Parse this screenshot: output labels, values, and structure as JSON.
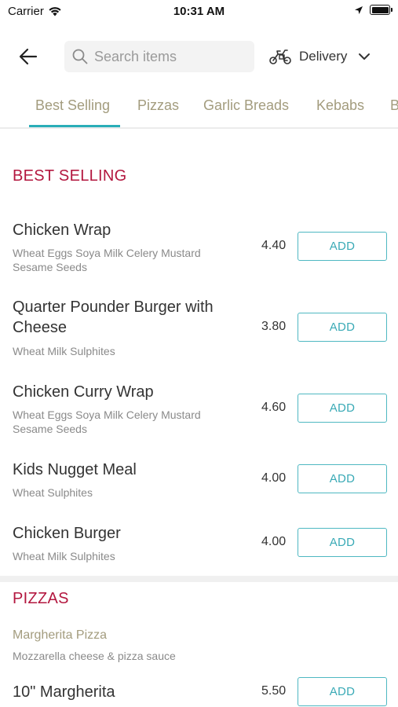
{
  "status_bar": {
    "carrier": "Carrier",
    "time": "10:31 AM"
  },
  "header": {
    "search_placeholder": "Search items",
    "delivery_label": "Delivery"
  },
  "tabs": [
    {
      "label": "Best Selling",
      "active": true
    },
    {
      "label": "Pizzas",
      "active": false
    },
    {
      "label": "Garlic Breads",
      "active": false
    },
    {
      "label": "Kebabs",
      "active": false
    },
    {
      "label": "B",
      "active": false
    }
  ],
  "sections": {
    "best_selling": {
      "title": "BEST SELLING",
      "items": [
        {
          "name": "Chicken Wrap",
          "allergens": "Wheat Eggs Soya Milk Celery Mustard\nSesame Seeds",
          "price": "4.40",
          "button": "ADD"
        },
        {
          "name": "Quarter Pounder Burger with\nCheese",
          "allergens": "Wheat Milk Sulphites",
          "price": "3.80",
          "button": "ADD"
        },
        {
          "name": "Chicken Curry Wrap",
          "allergens": "Wheat Eggs Soya Milk Celery Mustard\nSesame Seeds",
          "price": "4.60",
          "button": "ADD"
        },
        {
          "name": "Kids Nugget Meal",
          "allergens": "Wheat Sulphites",
          "price": "4.00",
          "button": "ADD"
        },
        {
          "name": "Chicken Burger",
          "allergens": "Wheat Milk Sulphites",
          "price": "4.00",
          "button": "ADD"
        }
      ]
    },
    "pizzas": {
      "title": "PIZZAS",
      "group_title": "Margherita Pizza",
      "group_desc": "Mozzarella cheese & pizza sauce",
      "items": [
        {
          "name": "10\" Margherita",
          "price": "5.50",
          "button": "ADD"
        }
      ]
    }
  },
  "colors": {
    "accent": "#2aaeb8",
    "section_title": "#b3173f",
    "tab_text": "#a39c7e"
  }
}
